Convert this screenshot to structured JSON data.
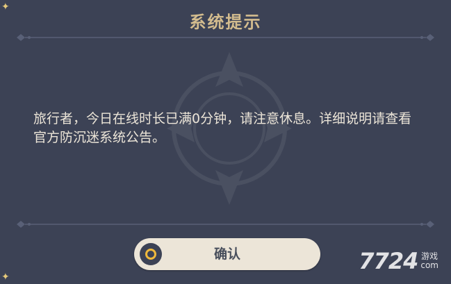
{
  "dialog": {
    "title": "系统提示",
    "message": "旅行者，今日在线时长已满0分钟，请注意休息。详细说明请查看官方防沉迷系统公告。",
    "confirm_label": "确认"
  },
  "watermark": {
    "number": "7724",
    "text_line1": "游戏",
    "text_line2": "com"
  },
  "colors": {
    "background": "#3c4255",
    "title": "#d3bc8e",
    "message": "#ece5d8",
    "button": "#ece5d8",
    "button_icon_ring": "#f0b93c"
  },
  "icons": {
    "divider": "ornamental-divider",
    "emblem": "faded-crest-emblem",
    "confirm": "circle-confirm-icon"
  }
}
